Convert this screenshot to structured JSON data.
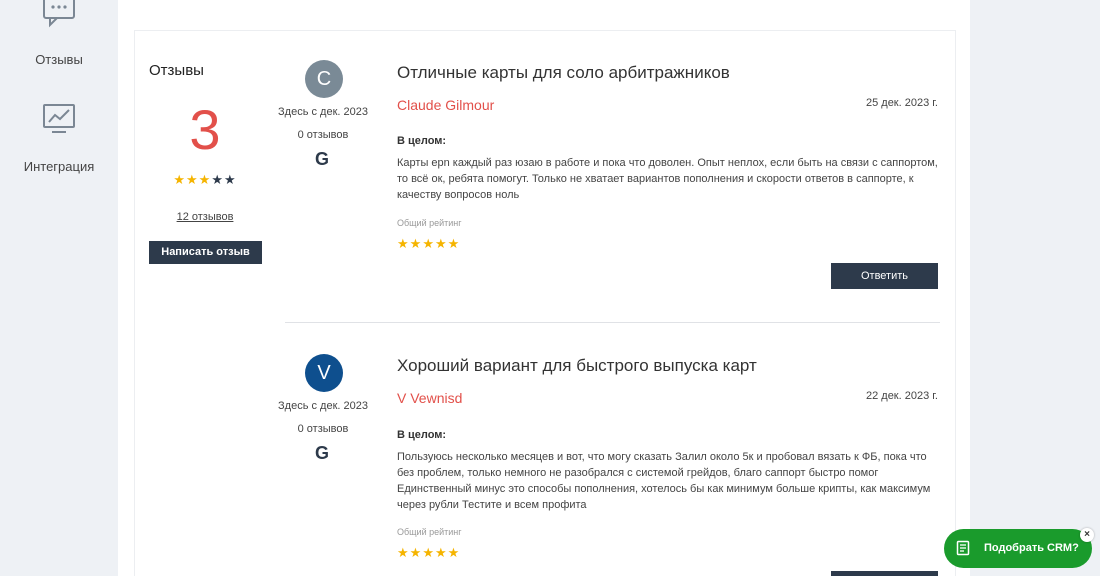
{
  "sidebar": {
    "items": [
      {
        "label": "Отзывы",
        "icon": "reviews-icon"
      },
      {
        "label": "Интеграция",
        "icon": "integration-chart-icon"
      }
    ]
  },
  "summary": {
    "title": "Отзывы",
    "score": "3",
    "stars_filled": 3,
    "stars_total": 5,
    "count_link": "12 отзывов",
    "write_button": "Написать отзыв"
  },
  "reviews": [
    {
      "avatar_letter": "C",
      "avatar_color": "#7a8a96",
      "since": "Здесь с дек. 2023",
      "count": "0 отзывов",
      "source_icon": "G",
      "title": "Отличные карты для соло арбитражников",
      "author": "Claude Gilmour",
      "date": "25 дек. 2023 г.",
      "overall_label": "В целом:",
      "text": "Карты epn каждый раз юзаю в работе и пока что доволен. Опыт неплох, если быть на связи с саппортом, то всё ок, ребята помогут. Только не хватает вариантов пополнения и скорости ответов в саппорте, к качеству вопросов ноль",
      "rating_label": "Общий рейтинг",
      "rating": 5,
      "reply_button": "Ответить"
    },
    {
      "avatar_letter": "V",
      "avatar_color": "#0e4f8e",
      "since": "Здесь с дек. 2023",
      "count": "0 отзывов",
      "source_icon": "G",
      "title": "Хороший вариант для быстрого выпуска карт",
      "author": "V Vewnisd",
      "date": "22 дек. 2023 г.",
      "overall_label": "В целом:",
      "text": "Пользуюсь несколько месяцев и вот, что могу сказать Залил около 5к и пробовал вязать к ФБ, пока что без проблем, только немного не разобрался с системой грейдов, благо саппорт быстро помог Единственный минус это способы пополнения, хотелось бы как минимум больше крипты, как максимум через рубли Тестите и всем профита",
      "rating_label": "Общий рейтинг",
      "rating": 5
    }
  ],
  "crm_widget": {
    "label": "Подобрать CRM?",
    "close": "×"
  },
  "colors": {
    "accent": "#e2504a",
    "dark_button": "#2d3a4b",
    "star": "#f5b400",
    "crm_green": "#1a9b2c"
  }
}
